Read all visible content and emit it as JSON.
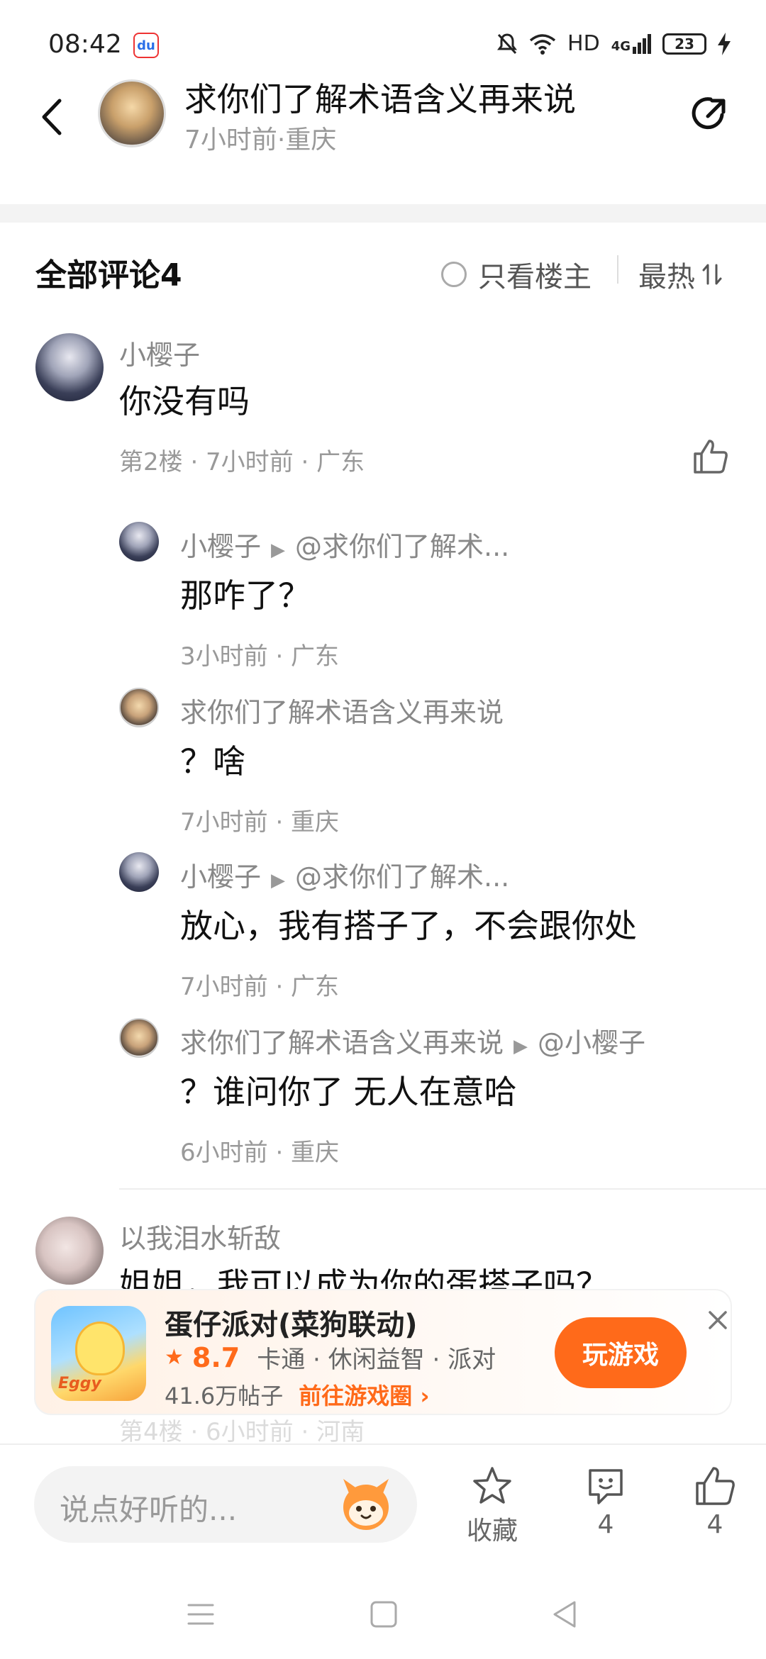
{
  "status_bar": {
    "time": "08:42",
    "signal_text": "HD",
    "network": "4G",
    "battery": "23"
  },
  "header": {
    "title": "求你们了解术语含义再来说",
    "meta": "7小时前·重庆"
  },
  "comments_bar": {
    "title": "全部评论4",
    "only_op_label": "只看楼主",
    "sort_label": "最热"
  },
  "comments": [
    {
      "author": "小樱子",
      "text": "你没有吗",
      "meta": "第2楼 · 7小时前 · 广东",
      "replies": [
        {
          "author": "小樱子",
          "reply_to": "@求你们了解术...",
          "text": "那咋了？",
          "meta": "3小时前 · 广东"
        },
        {
          "author": "求你们了解术语含义再来说",
          "reply_to": "",
          "text": "？啥",
          "meta": "7小时前 · 重庆"
        },
        {
          "author": "小樱子",
          "reply_to": "@求你们了解术...",
          "text": "放心，我有搭子了，不会跟你处",
          "meta": "7小时前 · 广东"
        },
        {
          "author": "求你们了解术语含义再来说",
          "reply_to": "@小樱子",
          "text": "？谁问你了 无人在意哈",
          "meta": "6小时前 · 重庆"
        }
      ]
    },
    {
      "author": "以我泪水斩敌",
      "text": "姐姐，我可以成为你的蛋搭子吗？",
      "meta": "第4楼 · 6小时前 · 河南"
    }
  ],
  "promo": {
    "name": "蛋仔派对(菜狗联动)",
    "score": "8.7",
    "tags": "卡通 · 休闲益智 · 派对",
    "posts": "41.6万帖子",
    "link": "前往游戏圈",
    "play": "玩游戏",
    "accent": "#ff6a1a"
  },
  "bottom_bar": {
    "input_placeholder": "说点好听的...",
    "favorite_label": "收藏",
    "comment_count": "4",
    "like_count": "4"
  }
}
